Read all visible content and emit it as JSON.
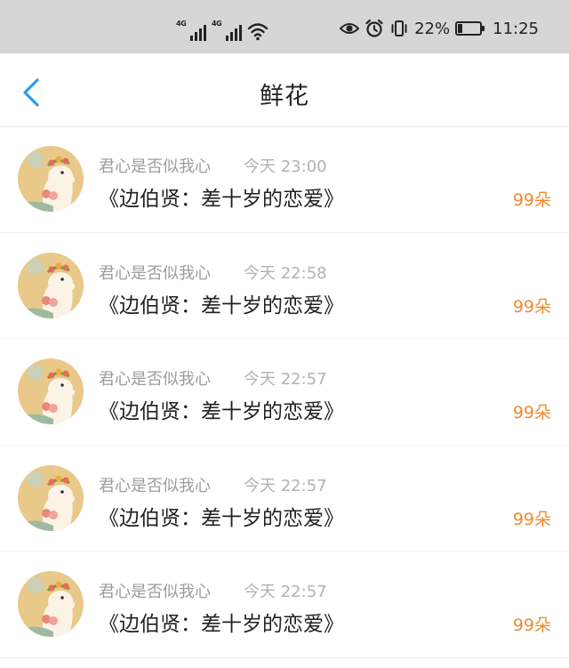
{
  "status_bar": {
    "network_1": "4G",
    "network_2": "4G",
    "battery_percent": "22%",
    "battery_level": 0.22,
    "time": "11:25",
    "icons": [
      "signal-icon",
      "signal-icon",
      "wifi-icon",
      "eye-icon",
      "alarm-icon",
      "vibrate-icon",
      "battery-icon"
    ]
  },
  "header": {
    "title": "鲜花",
    "back_icon": "chevron-left-icon",
    "accent_color": "#2b9cf2"
  },
  "list": {
    "count_color": "#f08a2e",
    "items": [
      {
        "user": "君心是否似我心",
        "time": "今天 23:00",
        "title": "《边伯贤：差十岁的恋爱》",
        "count": "99朵"
      },
      {
        "user": "君心是否似我心",
        "time": "今天 22:58",
        "title": "《边伯贤：差十岁的恋爱》",
        "count": "99朵"
      },
      {
        "user": "君心是否似我心",
        "time": "今天 22:57",
        "title": "《边伯贤：差十岁的恋爱》",
        "count": "99朵"
      },
      {
        "user": "君心是否似我心",
        "time": "今天 22:57",
        "title": "《边伯贤：差十岁的恋爱》",
        "count": "99朵"
      },
      {
        "user": "君心是否似我心",
        "time": "今天 22:57",
        "title": "《边伯贤：差十岁的恋爱》",
        "count": "99朵"
      }
    ]
  }
}
